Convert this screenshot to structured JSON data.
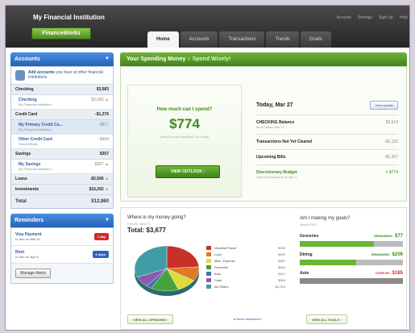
{
  "header": {
    "institution": "My Financial Institution",
    "logo": "FinanceWorks",
    "links": [
      "Account",
      "Settings",
      "Sign Up",
      "Help"
    ],
    "tabs": [
      {
        "label": "Home",
        "active": true
      },
      {
        "label": "Accounts",
        "active": false
      },
      {
        "label": "Transactions",
        "active": false
      },
      {
        "label": "Trends",
        "active": false
      },
      {
        "label": "Goals",
        "active": false
      }
    ]
  },
  "sidebar": {
    "accounts_title": "Accounts",
    "add_accounts": {
      "link": "Add accounts",
      "text": "you have at other financial institutions"
    },
    "groups": {
      "checking": {
        "label": "Checking",
        "total": "$3,083"
      },
      "credit": {
        "label": "Credit Card",
        "total": "-$1,276"
      },
      "savings": {
        "label": "Savings",
        "total": "$357"
      },
      "loans": {
        "label": "Loans",
        "total": "-$5,566"
      },
      "investments": {
        "label": "Investments",
        "total": "$16,262"
      }
    },
    "accounts": {
      "checking1": {
        "name": "Checking",
        "institution": "My Financial Institution",
        "value": "$3,083"
      },
      "credit1": {
        "name": "My Primary Credit Ca...",
        "institution": "My Financial Institution",
        "value": "-$817"
      },
      "credit2": {
        "name": "Other Credit Card",
        "institution": "Second Bank",
        "value": "-$459"
      },
      "savings1": {
        "name": "My Savings",
        "institution": "My Financial Institution",
        "value": "$357"
      }
    },
    "total_label": "Total",
    "total_value": "$12,860",
    "reminders_title": "Reminders",
    "reminders": [
      {
        "name": "Visa Payment",
        "due": "is due on Mar 27",
        "badge": "1 day",
        "badge_color": "#d42a2a"
      },
      {
        "name": "Rent",
        "due": "is due on Apr 6",
        "badge": "6 days",
        "badge_color": "#2d62c4"
      }
    ],
    "manage_alerts": "Manage Alerts"
  },
  "spending": {
    "bar_title": "Your Spending Money",
    "bar_sep": "›",
    "bar_subtitle": "Spend Wisely!",
    "question": "How much can I spend?",
    "amount": "$774",
    "note": "until your next paycheck on Friday",
    "outlook_button": "VIEW OUTLOOK",
    "today": {
      "title": "Today, Mar 27",
      "update_button": "View Update",
      "rows": [
        {
          "name": "CHECKING Balance",
          "sub": "as of Today, Mar 27",
          "value": "$3,614"
        },
        {
          "name": "Transactions Not Yet Cleared",
          "sub": "",
          "value": "-$1,192"
        },
        {
          "name": "Upcoming Bills",
          "sub": "",
          "value": "-$1,367"
        },
        {
          "name": "Discretionary Budget",
          "sub": "until next paycheck on Apr 3",
          "value": "= $774"
        }
      ]
    }
  },
  "where": {
    "title": "Where is my money going?",
    "subtitle": "Feb 25 - Mar 27",
    "total": "Total: $3,677",
    "view_spending": "VIEW ALL SPENDING",
    "help_link": "Need assistance?"
  },
  "goals": {
    "title": "Am I making my goals?",
    "subtitle": "March 2011",
    "items": [
      {
        "name": "Groceries",
        "status": "REMAINING",
        "amount": "$77",
        "status_color": "#3e8a1a",
        "fill": 0.72,
        "fill_color": "#6ab536"
      },
      {
        "name": "Dining",
        "status": "REMAINING",
        "amount": "$209",
        "status_color": "#3e8a1a",
        "fill": 0.55,
        "fill_color": "#6ab536"
      },
      {
        "name": "Auto",
        "status": "OVER BY",
        "amount": "$185",
        "status_color": "#d42a2a",
        "fill": 1.0,
        "fill_color": "#8a8a8a"
      }
    ],
    "view_goals": "VIEW ALL GOALS"
  },
  "chart_data": {
    "type": "pie",
    "categories": [
      "Vacation/Travel",
      "Loan",
      "Misc. Expense",
      "Groceries",
      "Auto",
      "Cash",
      "All Others"
    ],
    "values": [
      920,
      400,
      387,
      534,
      112,
      304,
      1210
    ],
    "labels": [
      "$920",
      "$400",
      "$387",
      "$534",
      "$112",
      "$304",
      "$1,210"
    ],
    "colors": [
      "#c8302a",
      "#e07a25",
      "#dcdc3a",
      "#45a33c",
      "#4a6fb3",
      "#8a5cb0",
      "#3f9da6"
    ]
  }
}
